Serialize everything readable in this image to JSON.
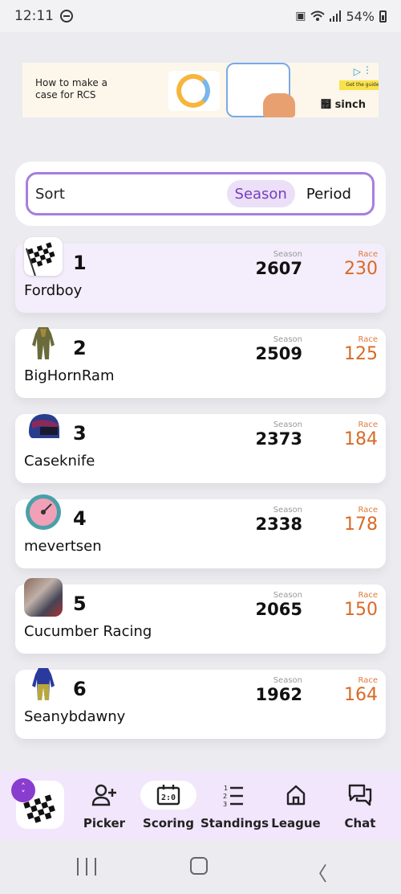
{
  "status_bar": {
    "time": "12:11",
    "battery": "54%"
  },
  "ad": {
    "headline": "How to make a case for RCS",
    "cta": "Get the guide",
    "brand": "sinch",
    "brand_symbol": "຿"
  },
  "sort": {
    "label": "Sort",
    "options": [
      "Season",
      "Period"
    ],
    "selected": "Season"
  },
  "standings": {
    "season_label": "Season",
    "race_label": "Race",
    "rows": [
      {
        "rank": "1",
        "name": "Fordboy",
        "season": "2607",
        "race": "230",
        "avatar": "checkered-flag"
      },
      {
        "rank": "2",
        "name": "BigHornRam",
        "season": "2509",
        "race": "125",
        "avatar": "race-suit"
      },
      {
        "rank": "3",
        "name": "Caseknife",
        "season": "2373",
        "race": "184",
        "avatar": "helmet"
      },
      {
        "rank": "4",
        "name": "mevertsen",
        "season": "2338",
        "race": "178",
        "avatar": "gauge"
      },
      {
        "rank": "5",
        "name": "Cucumber Racing",
        "season": "2065",
        "race": "150",
        "avatar": "photo"
      },
      {
        "rank": "6",
        "name": "Seanybdawny",
        "season": "1962",
        "race": "164",
        "avatar": "race-suit"
      }
    ]
  },
  "bottom_nav": {
    "items": [
      {
        "label": "Picker",
        "icon": "add-user-icon"
      },
      {
        "label": "Scoring",
        "icon": "scoreboard-icon",
        "active": true
      },
      {
        "label": "Standings",
        "icon": "ranked-list-icon"
      },
      {
        "label": "League",
        "icon": "home-icon"
      },
      {
        "label": "Chat",
        "icon": "chat-icon"
      }
    ]
  },
  "colors": {
    "accent": "#8a3ccf",
    "race_value": "#d86a26",
    "highlight_row": "#f4edfc",
    "nav_bg": "#f1e6fb"
  }
}
